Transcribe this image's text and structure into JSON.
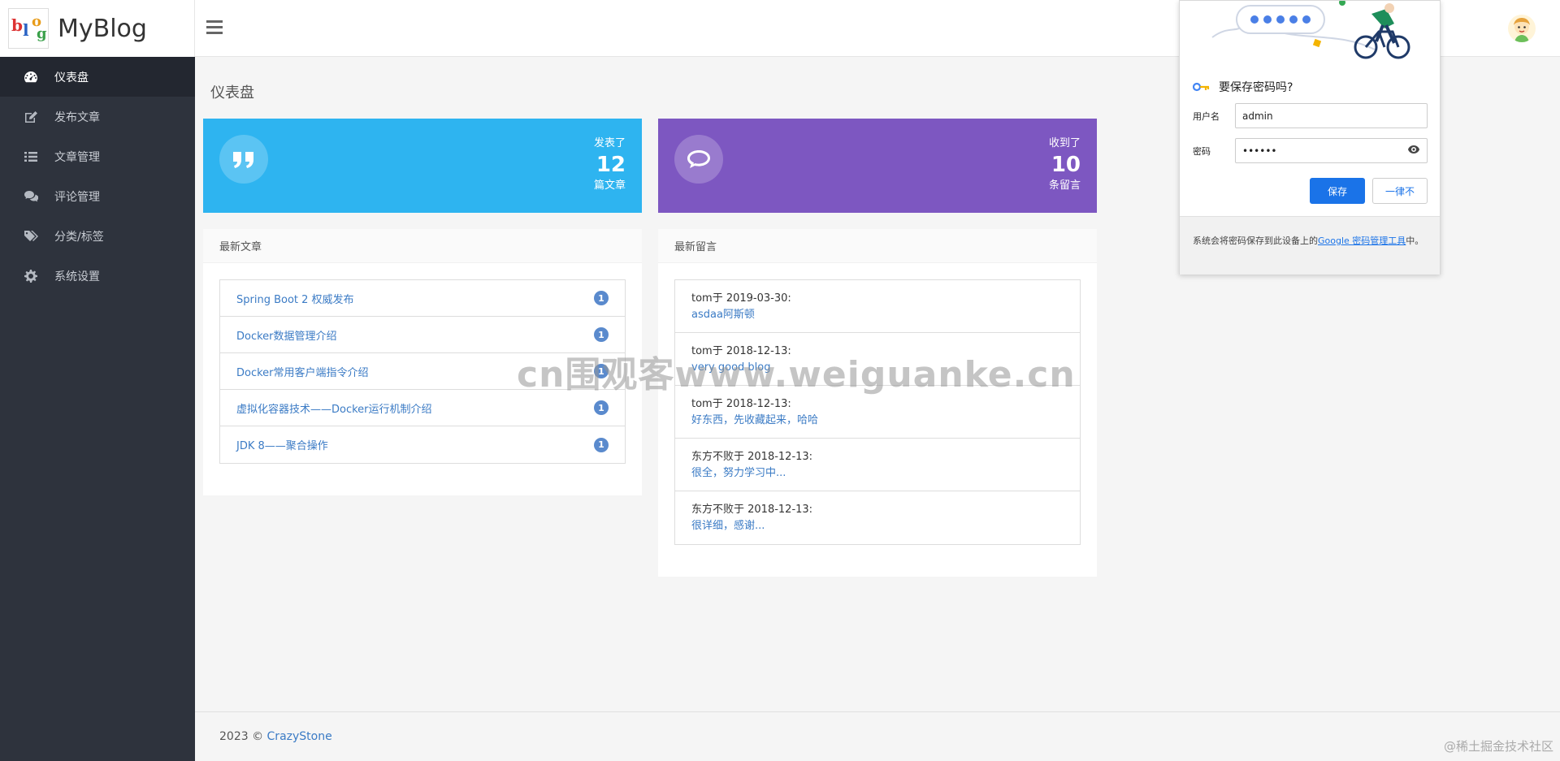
{
  "brand": {
    "name": "MyBlog",
    "logo_text": "blog"
  },
  "sidebar": {
    "items": [
      {
        "label": "仪表盘",
        "icon": "dashboard-icon",
        "active": true
      },
      {
        "label": "发布文章",
        "icon": "edit-icon"
      },
      {
        "label": "文章管理",
        "icon": "list-icon"
      },
      {
        "label": "评论管理",
        "icon": "comments-icon"
      },
      {
        "label": "分类/标签",
        "icon": "tags-icon"
      },
      {
        "label": "系统设置",
        "icon": "gear-icon"
      }
    ]
  },
  "page": {
    "title": "仪表盘"
  },
  "stats": [
    {
      "label": "发表了",
      "value": "12",
      "unit": "篇文章",
      "icon": "quote-icon",
      "color": "#2eb4f0"
    },
    {
      "label": "收到了",
      "value": "10",
      "unit": "条留言",
      "icon": "chat-icon",
      "color": "#7d57c1"
    }
  ],
  "latest_articles": {
    "title": "最新文章",
    "items": [
      {
        "title": "Spring Boot 2 权威发布",
        "count": "1"
      },
      {
        "title": "Docker数据管理介绍",
        "count": "1"
      },
      {
        "title": "Docker常用客户端指令介绍",
        "count": "1"
      },
      {
        "title": "虚拟化容器技术——Docker运行机制介绍",
        "count": "1"
      },
      {
        "title": "JDK 8——聚合操作",
        "count": "1"
      }
    ]
  },
  "latest_comments": {
    "title": "最新留言",
    "items": [
      {
        "author": "tom于 2019-03-30:",
        "content": "asdaa阿斯顿"
      },
      {
        "author": "tom于 2018-12-13:",
        "content": "very good blog"
      },
      {
        "author": "tom于 2018-12-13:",
        "content": "好东西，先收藏起来，哈哈"
      },
      {
        "author": "东方不败于 2018-12-13:",
        "content": "很全，努力学习中..."
      },
      {
        "author": "东方不败于 2018-12-13:",
        "content": "很详细，感谢..."
      }
    ]
  },
  "footer": {
    "copyright": "2023 © ",
    "link": "CrazyStone"
  },
  "watermark": "cn围观客www.weiguanke.cn",
  "corner_mark": "@稀土掘金技术社区",
  "password_popup": {
    "title": "要保存密码吗?",
    "username_label": "用户名",
    "username_value": "admin",
    "password_label": "密码",
    "password_value": "••••••",
    "save_label": "保存",
    "never_label": "一律不",
    "footer_text": "系统会将密码保存到此设备上的",
    "footer_link": "Google 密码管理工具",
    "footer_suffix": "中。"
  }
}
